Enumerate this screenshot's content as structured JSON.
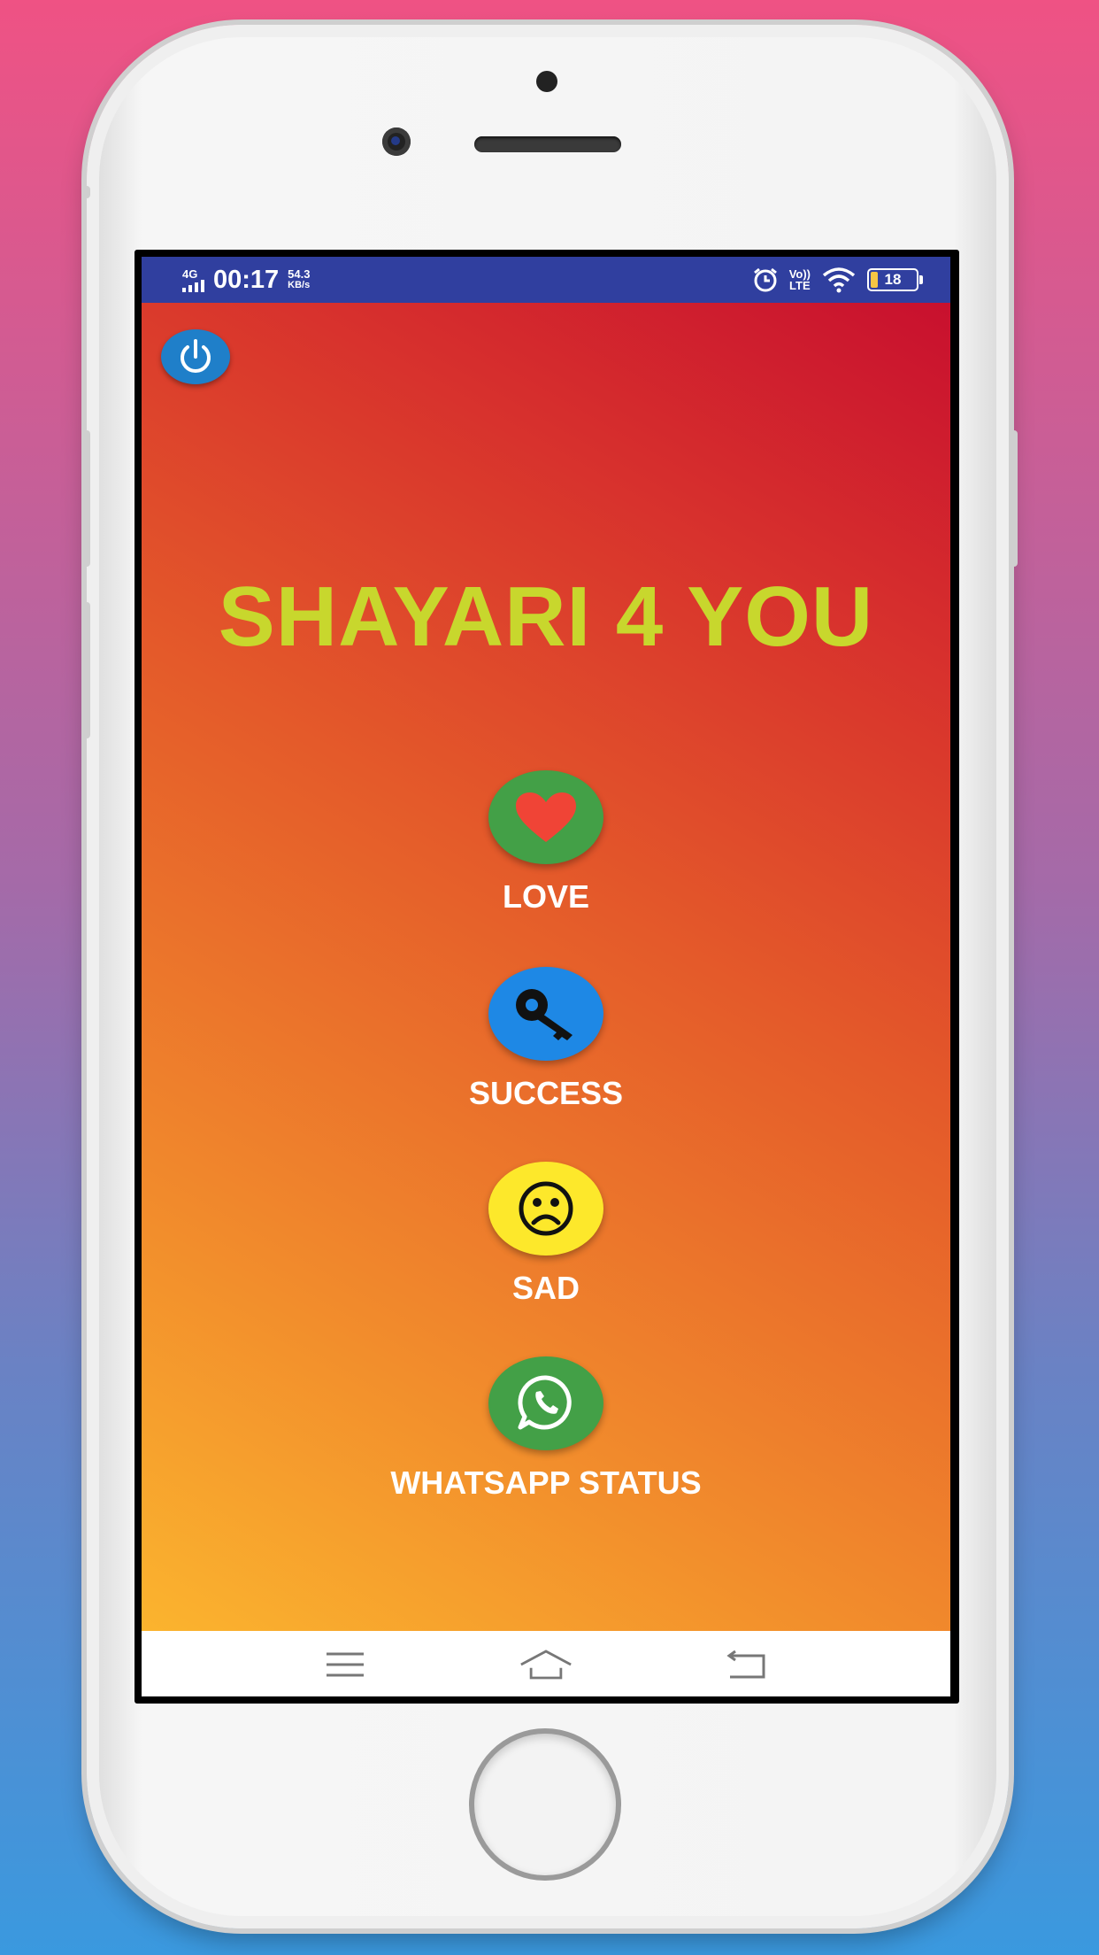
{
  "status_bar": {
    "network": "4G",
    "time": "00:17",
    "speed_value": "54.3",
    "speed_unit": "KB/s",
    "volte_top": "Vo))",
    "volte_bottom": "LTE",
    "battery": "18",
    "icons": [
      "signal-icon",
      "alarm-icon",
      "wifi-icon",
      "battery-icon"
    ]
  },
  "app": {
    "title": "SHAYARI 4 YOU",
    "categories": [
      {
        "label": "LOVE",
        "icon": "heart-icon",
        "color": "#43a047"
      },
      {
        "label": "SUCCESS",
        "icon": "key-icon",
        "color": "#1e88e5"
      },
      {
        "label": "SAD",
        "icon": "sad-face-icon",
        "color": "#fde82b"
      },
      {
        "label": "WHATSAPP STATUS",
        "icon": "whatsapp-icon",
        "color": "#43a047"
      }
    ],
    "power_icon": "power-icon"
  },
  "navigation_bar": {
    "items": [
      "menu-icon",
      "home-icon",
      "back-icon"
    ]
  },
  "colors": {
    "title": "#c8d72d",
    "status_bar": "#303f9f",
    "gradient_start": "#fbb42e",
    "gradient_end": "#c8102e"
  }
}
